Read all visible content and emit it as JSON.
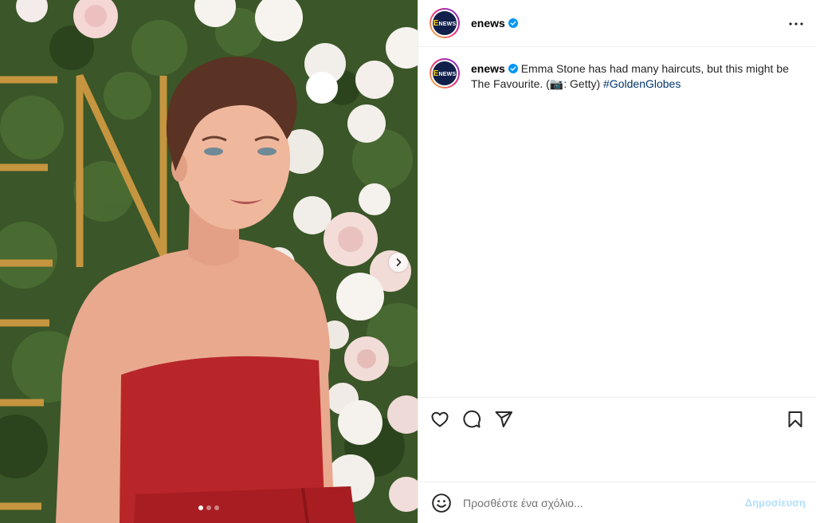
{
  "post": {
    "username": "enews",
    "verified": true,
    "avatar_logo": {
      "letter": "E",
      "word": "NEWS"
    },
    "caption": {
      "username": "enews",
      "text": "Emma Stone has had many haircuts, but this might be The Favourite. (📷: Getty)",
      "hashtag": "#GoldenGlobes"
    }
  },
  "media": {
    "carousel": {
      "total_slides": 3,
      "active_slide": 1
    }
  },
  "icons": {
    "more": "more-options-icon",
    "like": "heart-icon",
    "comment": "comment-icon",
    "share": "send-icon",
    "save": "bookmark-icon",
    "emoji": "emoji-icon",
    "next": "chevron-right-icon"
  },
  "comment": {
    "placeholder": "Προσθέστε ένα σχόλιο...",
    "post_label": "Δημοσίευση"
  },
  "colors": {
    "verified": "#0095f6",
    "hashtag": "#00376b",
    "post_button_disabled": "#b2dffc",
    "border": "#efefef"
  }
}
